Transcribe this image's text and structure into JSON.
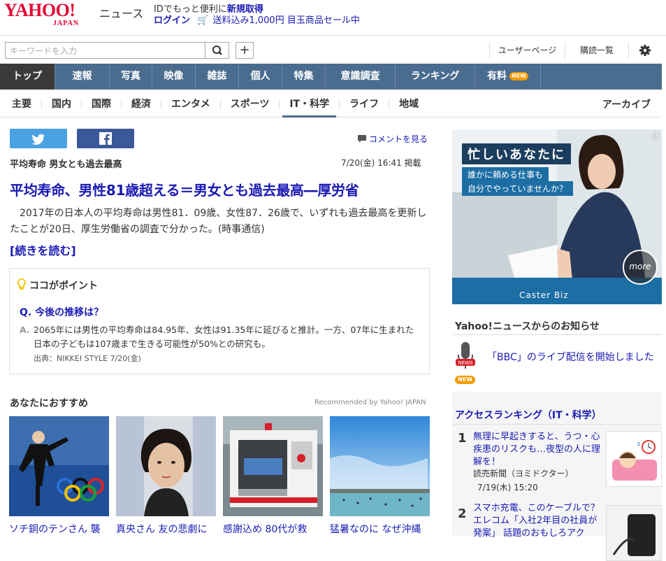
{
  "header": {
    "logo_main": "YAHOO!",
    "logo_sub": "JAPAN",
    "service_name": "ニュース",
    "promo_prefix": "IDでもっと便利に",
    "promo_link": "新規取得",
    "login": "ログイン",
    "sale": "送料込み1,000円 目玉商品セール中"
  },
  "searchbar": {
    "placeholder": "キーワードを入力",
    "user_page": "ユーザーページ",
    "reading_list": "購読一覧"
  },
  "nav": {
    "items": [
      {
        "label": "トップ"
      },
      {
        "label": "速報"
      },
      {
        "label": "写真"
      },
      {
        "label": "映像"
      },
      {
        "label": "雑誌"
      },
      {
        "label": "個人"
      },
      {
        "label": "特集"
      },
      {
        "label": "意識調査"
      },
      {
        "label": "ランキング"
      },
      {
        "label": "有料"
      }
    ],
    "new_badge": "NEW"
  },
  "subnav": {
    "items": [
      {
        "label": "主要"
      },
      {
        "label": "国内"
      },
      {
        "label": "国際"
      },
      {
        "label": "経済"
      },
      {
        "label": "エンタメ"
      },
      {
        "label": "スポーツ"
      },
      {
        "label": "IT・科学"
      },
      {
        "label": "ライフ"
      },
      {
        "label": "地域"
      }
    ],
    "archive": "アーカイブ"
  },
  "article": {
    "comment_link": "コメントを見る",
    "kicker": "平均寿命 男女とも過去最高",
    "date": "7/20(金) 16:41 掲載",
    "title": "平均寿命、男性81歳超える＝男女とも過去最高―厚労省",
    "body": "2017年の日本人の平均寿命は男性81．09歳、女性87．26歳で、いずれも過去最高を更新したことが20日、厚生労働省の調査で分かった。(時事通信)",
    "read_more": "[続きを読む]"
  },
  "point": {
    "heading": "ココがポイント",
    "question_label": "Q.",
    "question": "今後の推移は？",
    "answer_label": "A.",
    "answer": "2065年には男性の平均寿命は84.95年、女性は91.35年に延びると推計。一方、07年に生まれた日本の子どもは107歳まで生きる可能性が50%との研究も。",
    "source": "出典：NIKKEI STYLE 7/20(金)"
  },
  "recommend": {
    "heading": "あなたにおすすめ",
    "by": "Recommended by Yahoo! JAPAN",
    "cards": [
      {
        "caption": "ソチ銅のテンさん 襲"
      },
      {
        "caption": "真央さん 友の悲劇に"
      },
      {
        "caption": "感謝込め 80代が救"
      },
      {
        "caption": "猛暑なのに なぜ沖縄"
      }
    ]
  },
  "ad": {
    "headline": "忙しいあなたに",
    "sub1": "誰かに頼める仕事も",
    "sub2": "自分でやっていませんか？",
    "more": "more",
    "brand": "Caster Biz"
  },
  "notice": {
    "heading": "Yahoo!ニュースからのお知らせ",
    "text": "「BBC」のライブ配信を開始しました",
    "badge": "NEW"
  },
  "ranking": {
    "heading": "アクセスランキング（IT・科学）",
    "items": [
      {
        "rank": "1",
        "title": "無理に早起きすると、うつ・心疾患のリスクも…夜型の人に理解を！",
        "source": "読売新聞（ヨミドクター）",
        "date": "7/19(木) 15:20"
      },
      {
        "rank": "2",
        "title": "スマホ充電、このケーブルで？ エレコム「入社2年目の社員が発案」 話題のおもしろアク",
        "source": "",
        "date": ""
      }
    ]
  },
  "colors": {
    "brand_red": "#e60033",
    "link_blue": "#1a1ab4",
    "nav_bg": "#4a6c8e",
    "nav_active": "#3a3a3a",
    "badge_orange": "#f29b00"
  }
}
